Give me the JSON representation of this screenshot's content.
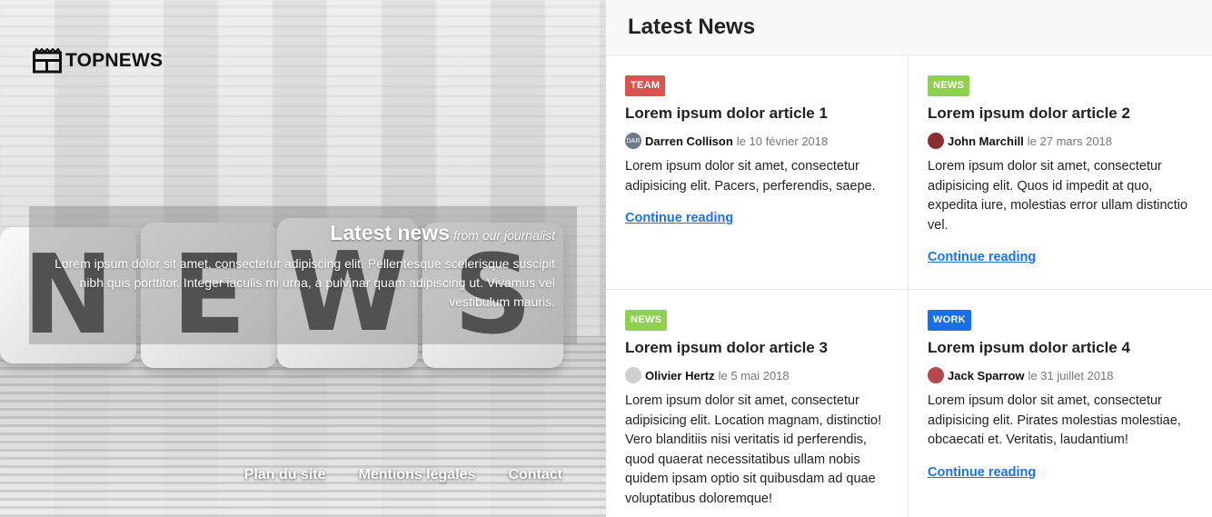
{
  "brand": {
    "name": "TOPNEWS"
  },
  "hero": {
    "title": "Latest news",
    "subtitle": "from our journalist",
    "text": "Lorem ipsum dolor sit amet, consectetur adipiscing elit. Pellentesque scelerisque suscipit nibh quis porttitor. Integer iaculis mi urna, a pulvinar quam adipiscing ut. Vivamus vel vestibulum mauris.",
    "cube_letters": [
      "N",
      "E",
      "W",
      "S"
    ]
  },
  "footer": {
    "links": [
      "Plan du site",
      "Mentions légales",
      "Contact"
    ]
  },
  "panel": {
    "title": "Latest News",
    "read_more": "Continue reading",
    "articles": [
      {
        "tag": "TEAM",
        "tag_color": "#d9534f",
        "title": "Lorem ipsum dolor article 1",
        "author": "Darren Collison",
        "date": "le 10 février 2018",
        "avatar_color": "#6c7a89",
        "avatar_text": "DAR",
        "excerpt": "Lorem ipsum dolor sit amet, consectetur adipisicing elit. Pacers, perferendis, saepe."
      },
      {
        "tag": "NEWS",
        "tag_color": "#8fd14f",
        "title": "Lorem ipsum dolor article 2",
        "author": "John Marchill",
        "date": "le 27 mars 2018",
        "avatar_color": "#8b2e2e",
        "avatar_text": "",
        "excerpt": "Lorem ipsum dolor sit amet, consectetur adipisicing elit. Quos id impedit at quo, expedita iure, molestias error ullam distinctio vel."
      },
      {
        "tag": "NEWS",
        "tag_color": "#8fd14f",
        "title": "Lorem ipsum dolor article 3",
        "author": "Olivier Hertz",
        "date": "le 5 mai 2018",
        "avatar_color": "#cfcfcf",
        "avatar_text": "",
        "excerpt": "Lorem ipsum dolor sit amet, consectetur adipisicing elit. Location magnam, distinctio! Vero blanditiis nisi veritatis id perferendis, quod quaerat necessitatibus ullam nobis quidem ipsam optio sit quibusdam ad quae voluptatibus doloremque!"
      },
      {
        "tag": "WORK",
        "tag_color": "#1a6fe8",
        "title": "Lorem ipsum dolor article 4",
        "author": "Jack Sparrow",
        "date": "le 31 juillet 2018",
        "avatar_color": "#b5494e",
        "avatar_text": "",
        "excerpt": "Lorem ipsum dolor sit amet, consectetur adipisicing elit. Pirates molestias molestiae, obcaecati et. Veritatis, laudantium!"
      }
    ]
  }
}
